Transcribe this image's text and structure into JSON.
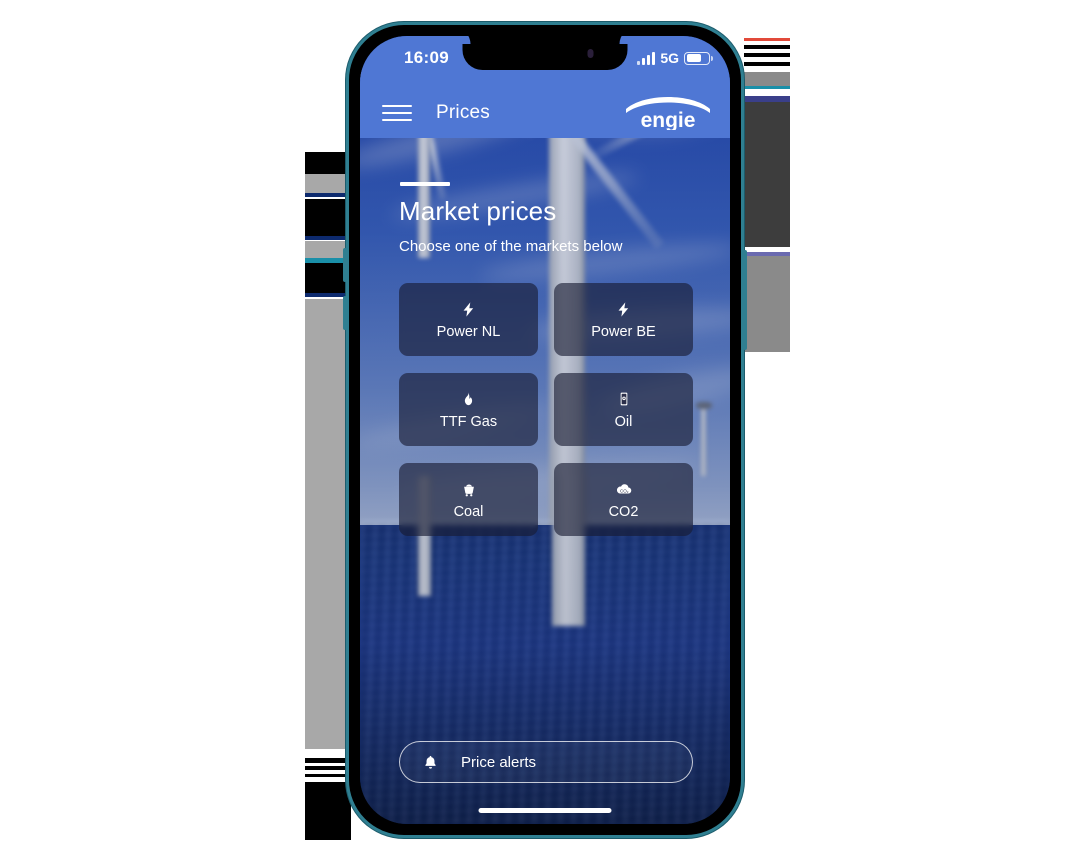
{
  "device": {
    "frame_color": "#2f7f91",
    "bezel_color": "#000000"
  },
  "status_bar": {
    "time": "16:09",
    "network": "5G",
    "signal_icon": "signal-bars-icon",
    "battery_icon": "battery-icon",
    "battery_level_pct": 62,
    "background_color": "#4f77d4"
  },
  "app_bar": {
    "menu_icon": "hamburger-menu-icon",
    "title": "Prices",
    "brand_logo_text": "engie",
    "background_color": "#4f77d4"
  },
  "content": {
    "page_title": "Market prices",
    "subtitle": "Choose one of the markets below",
    "markets": [
      {
        "label": "Power NL",
        "icon": "lightning-bolt-icon"
      },
      {
        "label": "Power BE",
        "icon": "lightning-bolt-icon"
      },
      {
        "label": "TTF Gas",
        "icon": "flame-icon"
      },
      {
        "label": "Oil",
        "icon": "oil-barrel-icon"
      },
      {
        "label": "Coal",
        "icon": "coal-cart-icon"
      },
      {
        "label": "CO2",
        "icon": "cloud-icon"
      }
    ],
    "card_background_color": "#161a30"
  },
  "price_alerts": {
    "label": "Price alerts",
    "icon": "bell-icon"
  },
  "background": {
    "description": "offshore wind turbines at sea",
    "sky_color": "#2b51b4",
    "sea_color": "#21409a"
  }
}
